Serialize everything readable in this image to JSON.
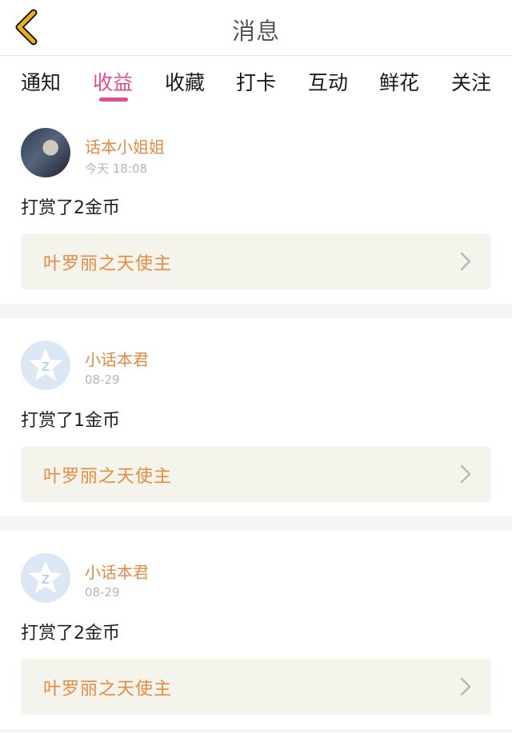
{
  "header": {
    "title": "消息",
    "back_icon": "chevron-left-icon"
  },
  "tabs": [
    {
      "label": "通知",
      "active": false
    },
    {
      "label": "收益",
      "active": true
    },
    {
      "label": "收藏",
      "active": false
    },
    {
      "label": "打卡",
      "active": false
    },
    {
      "label": "互动",
      "active": false
    },
    {
      "label": "鲜花",
      "active": false
    },
    {
      "label": "关注",
      "active": false
    }
  ],
  "messages": [
    {
      "username": "话本小姐姐",
      "time": "今天 18:08",
      "text": "打赏了2金币",
      "link_title": "叶罗丽之天使主",
      "avatar": "photo"
    },
    {
      "username": "小话本君",
      "time": "08-29",
      "text": "打赏了1金币",
      "link_title": "叶罗丽之天使主",
      "avatar": "default-z-star"
    },
    {
      "username": "小话本君",
      "time": "08-29",
      "text": "打赏了2金币",
      "link_title": "叶罗丽之天使主",
      "avatar": "default-z-star"
    }
  ],
  "colors": {
    "accent_pink": "#e04f8d",
    "accent_orange": "#e58a45",
    "back_icon_yellow": "#e8b21c",
    "link_card_bg": "#f4f4ec"
  }
}
